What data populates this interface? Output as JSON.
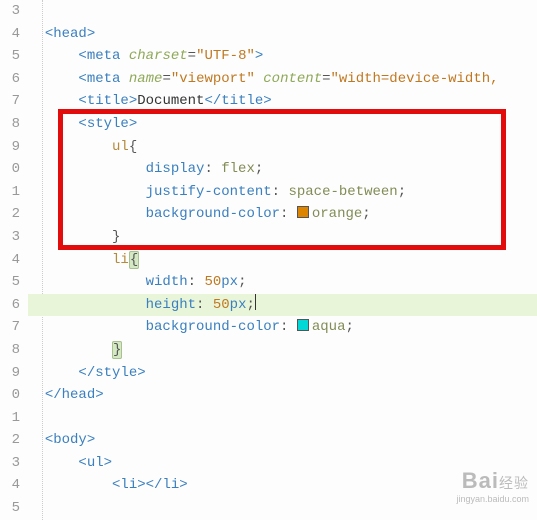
{
  "gutter": [
    "3",
    "4",
    "5",
    "6",
    "7",
    "8",
    "9",
    "0",
    "1",
    "2",
    "3",
    "4",
    "5",
    "6",
    "7",
    "8",
    "9",
    "0",
    "1",
    "2",
    "3",
    "4",
    "5"
  ],
  "code": {
    "l3": "",
    "l4": {
      "tag_open": "<",
      "tag_name": "head",
      "tag_close": ">"
    },
    "l5": {
      "open": "<",
      "tag": "meta",
      "sp": " ",
      "attr": "charset",
      "eq": "=",
      "val": "\"UTF-8\"",
      "close": ">"
    },
    "l6": {
      "open": "<",
      "tag": "meta",
      "sp": " ",
      "attr1": "name",
      "eq": "=",
      "val1": "\"viewport\"",
      "sp2": " ",
      "attr2": "content",
      "val2": "\"width=device-width,"
    },
    "l7": {
      "open": "<",
      "tag": "title",
      "close": ">",
      "text": "Document",
      "open2": "</",
      "close2": ">"
    },
    "l8": {
      "open": "<",
      "tag": "style",
      "close": ">"
    },
    "l9": {
      "sel": "ul",
      "brace": "{"
    },
    "l10": {
      "prop": "display",
      "colon": ": ",
      "val": "flex",
      "semi": ";"
    },
    "l11": {
      "prop": "justify-content",
      "colon": ": ",
      "val": "space-between",
      "semi": ";"
    },
    "l12": {
      "prop": "background-color",
      "colon": ": ",
      "swatch": "#dd8500",
      "val": "orange",
      "semi": ";"
    },
    "l13": {
      "brace": "}"
    },
    "l14": {
      "sel": "li",
      "brace": "{"
    },
    "l15": {
      "prop": "width",
      "colon": ": ",
      "num": "50",
      "unit": "px",
      "semi": ";"
    },
    "l16": {
      "prop": "height",
      "colon": ": ",
      "num": "50",
      "unit": "px",
      "semi": ";"
    },
    "l17": {
      "prop": "background-color",
      "colon": ": ",
      "swatch": "#00d8d8",
      "val": "aqua",
      "semi": ";"
    },
    "l18": {
      "brace": "}"
    },
    "l19": {
      "open": "</",
      "tag": "style",
      "close": ">"
    },
    "l20": {
      "open": "</",
      "tag": "head",
      "close": ">"
    },
    "l21": "",
    "l22": {
      "open": "<",
      "tag": "body",
      "close": ">"
    },
    "l23": {
      "open": "<",
      "tag": "ul",
      "close": ">"
    },
    "l24": {
      "open": "<",
      "tag": "li",
      "close": ">",
      "open2": "</",
      "close2": ">"
    }
  },
  "watermark": {
    "brand": "Bai",
    "brand2": "经验",
    "url": "jingyan.baidu.com"
  }
}
